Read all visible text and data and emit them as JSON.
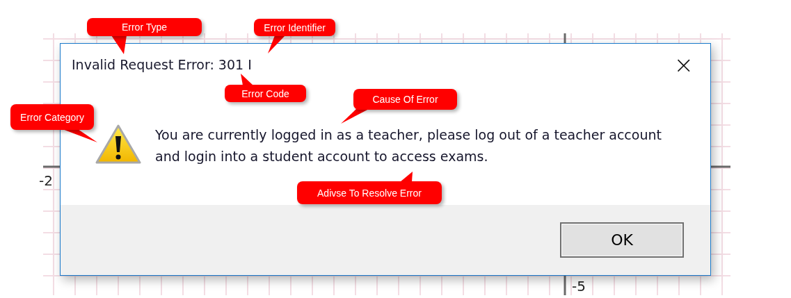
{
  "background": {
    "axis_labels": [
      "-2",
      "-5"
    ]
  },
  "dialog": {
    "title": "Invalid Request Error: 301 I",
    "close": "×",
    "message": "You are currently logged in as a teacher, please log out of a teacher account and login into a student account to access exams.",
    "buttons": [
      {
        "label": "OK"
      }
    ]
  },
  "callouts": [
    {
      "text": "Error Type"
    },
    {
      "text": "Error Identifier"
    },
    {
      "text": "Error Code"
    },
    {
      "text": "Cause Of Error"
    },
    {
      "text": "Error Category"
    },
    {
      "text": "Adivse To Resolve Error"
    }
  ]
}
